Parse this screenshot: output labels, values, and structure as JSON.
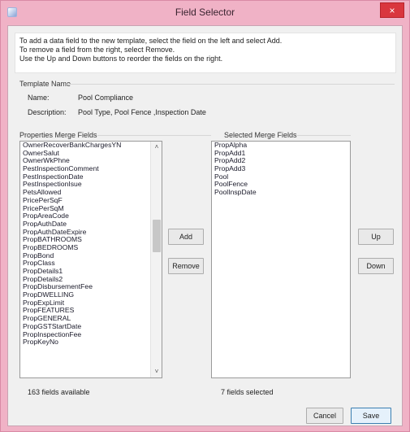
{
  "window": {
    "title": "Field Selector",
    "close_glyph": "×"
  },
  "instructions": [
    "To add a data field to the new template, select the field on the left and select Add.",
    "To remove a field from the right, select Remove.",
    "Use the Up and Down buttons to reorder the fields on the right."
  ],
  "template": {
    "group_label": "Template Name",
    "name_label": "Name:",
    "name_value": "Pool Compliance",
    "description_label": "Description:",
    "description_value": "Pool Type, Pool Fence ,Inspection Date"
  },
  "properties": {
    "label": "Properties Merge Fields",
    "items": [
      "OwnerRecoverBankChargesYN",
      "OwnerSalut",
      "OwnerWkPhne",
      "PestInspectionComment",
      "PestInspectionDate",
      "PestInspectionIsue",
      "PetsAllowed",
      "PricePerSqF",
      "PricePerSqM",
      "PropAreaCode",
      "PropAuthDate",
      "PropAuthDateExpire",
      "PropBATHROOMS",
      "PropBEDROOMS",
      "PropBond",
      "PropClass",
      "PropDetails1",
      "PropDetails2",
      "PropDisbursementFee",
      "PropDWELLING",
      "PropExpLimit",
      "PropFEATURES",
      "PropGENERAL",
      "PropGSTStartDate",
      "PropInspectionFee",
      "PropKeyNo"
    ],
    "count_text": "163 fields available"
  },
  "selected": {
    "label": "Selected Merge Fields",
    "items": [
      "PropAlpha",
      "PropAdd1",
      "PropAdd2",
      "PropAdd3",
      "Pool",
      "PoolFence",
      "PoolInspDate"
    ],
    "count_text": "7 fields selected"
  },
  "buttons": {
    "add": "Add",
    "remove": "Remove",
    "up": "Up",
    "down": "Down",
    "cancel": "Cancel",
    "save": "Save"
  },
  "scroll": {
    "up_glyph": "˄",
    "down_glyph": "˅"
  }
}
